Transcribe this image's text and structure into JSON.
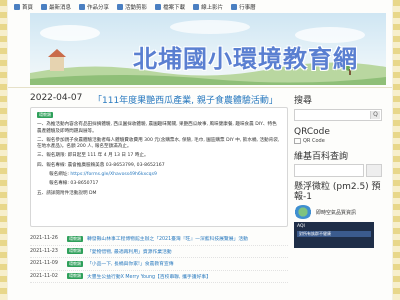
{
  "nav": [
    {
      "label": "首頁",
      "icon": "home-icon",
      "color": "#4a7fc1"
    },
    {
      "label": "最新消息",
      "icon": "news-icon",
      "color": "#4a7fc1"
    },
    {
      "label": "作品分享",
      "icon": "pencil-icon",
      "color": "#4a7fc1"
    },
    {
      "label": "活動剪影",
      "icon": "gallery-icon",
      "color": "#4a7fc1"
    },
    {
      "label": "檔案下載",
      "icon": "download-icon",
      "color": "#4a7fc1"
    },
    {
      "label": "線上影片",
      "icon": "video-icon",
      "color": "#4a7fc1"
    },
    {
      "label": "行事曆",
      "icon": "calendar-icon",
      "color": "#4a7fc1"
    }
  ],
  "banner": {
    "title": "北埔國小環境教育網"
  },
  "post": {
    "date": "2022-04-07",
    "title": "「111年度果艷西瓜產業, 親子食農體驗活動」",
    "tag": "環教類",
    "p1": "一、為推活動內容含有品田採摘體驗, 西瓜園採收體驗, 農園趣味闖關, 果艷西瓜故事, 風味健康餐, 趣味食農 DIY、特色農產體驗及即時問題與展等。",
    "p2": "二、報名參加親子食農體驗活動者每人體驗費收費用 300 元(含購票水, 保險, 毛巾, 園區購票 DIY 中, 飲水桶, 活動背袋, 在地水產品)。名額 200 人, 報名至額滿為止。",
    "p3": "三、報名期限: 即日起至 111 年 4 月 13 日 17 時止。",
    "p4": "四、報名專線: 農會推廣股賴美蓉 03-8653799, 03-8652167",
    "p5_label": "報名網址: ",
    "p5_link": "https://forms.gle/Xhavoss49h6kxcqs9",
    "p6_label": "報名專線: ",
    "p6_value": "03-8650717",
    "p7": "五、請詳閱附件活動說明 DM"
  },
  "list": [
    {
      "date": "2021-11-26",
      "tag": "環教類",
      "title": "轉發縣山林事工程博物館主辦之「2021臺灣『旺』—深藍科技展覽展」活動"
    },
    {
      "date": "2021-11-23",
      "tag": "環教類",
      "title": "「愛物惜物, 最適再利用」資源作業活動"
    },
    {
      "date": "2021-11-09",
      "tag": "環教類",
      "title": "「小品一下, 長桶與你家!」食農教育宣傳"
    },
    {
      "date": "2021-11-02",
      "tag": "環教類",
      "title": "大豐生公益行動X Merry Young【百校串聯, 攜手護好事】"
    }
  ],
  "sidebar": {
    "search_heading": "搜尋",
    "search_button": "Q",
    "qr_heading": "QRCode",
    "qr_caption": "QR Code",
    "wiki_heading": "維基百科查詢",
    "pm_heading": "懸浮微粒 (pm2.5) 預報-1",
    "pm_station": "即時空氣品質資訊",
    "aqi_title": "AQI",
    "aqi_subtitle": "對所有族群不健康"
  },
  "colors": {
    "accent": "#2a7abf",
    "tag": "#2fa05a",
    "banner_text": "#5a7fd1"
  }
}
